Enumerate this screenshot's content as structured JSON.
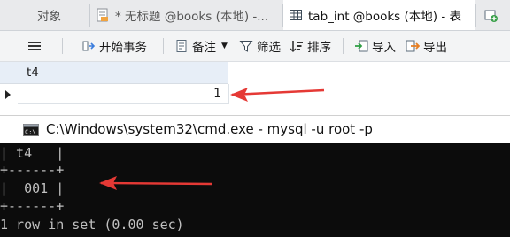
{
  "tabs": [
    {
      "label": "对象",
      "active": false
    },
    {
      "label": "* 无标题 @books (本地) -...",
      "active": false
    },
    {
      "label": "tab_int @books (本地) - 表",
      "active": true
    }
  ],
  "toolbar": {
    "menu_icon": "hamburger-icon",
    "begin_transaction": "开始事务",
    "notes": "备注",
    "filter": "筛选",
    "sort": "排序",
    "import": "导入",
    "export": "导出"
  },
  "grid": {
    "columns": [
      "t4"
    ],
    "rows": [
      [
        "1"
      ]
    ]
  },
  "cmd": {
    "title": "C:\\Windows\\system32\\cmd.exe - mysql  -u root -p",
    "lines": [
      "| t4   |",
      "+------+",
      "|  001 |",
      "+------+",
      "1 row in set (0.00 sec)"
    ]
  },
  "colors": {
    "arrow": "#e53935",
    "header_bg": "#e7eef7",
    "console_bg": "#0c0c0c"
  }
}
